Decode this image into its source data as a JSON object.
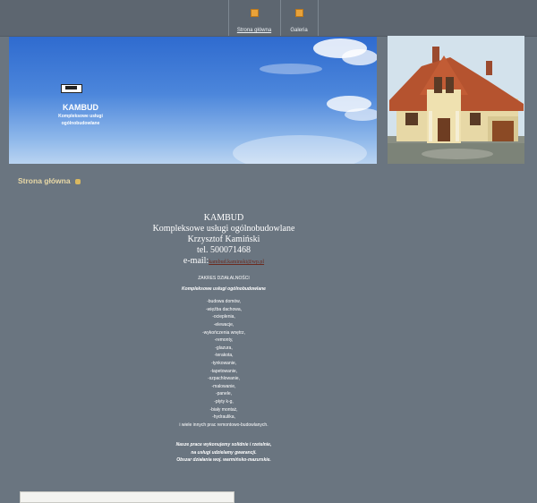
{
  "nav": {
    "items": [
      {
        "label": "Strona główna",
        "icon": "page-icon",
        "active": true
      },
      {
        "label": "Galeria",
        "icon": "page-icon",
        "active": false
      }
    ]
  },
  "banner": {
    "logo_alt": "logo",
    "name": "KAMBUD",
    "subtitle_line1": "Kompleksowe usługi",
    "subtitle_line2": "ogólnobudowlane"
  },
  "page": {
    "title": "Strona główna"
  },
  "contact": {
    "company": "KAMBUD",
    "services": "Kompleksowe usługi ogólnobudowlane",
    "owner": "Krzysztof Kamiński",
    "phone": "tel. 500071468",
    "email_label": "e-mail:",
    "email": "kambud.kaminski@wp.pl"
  },
  "scope": {
    "heading": "ZAKRES DZIAŁALNOŚCI",
    "subheading": "Kompleksowe usługi ogólnobudowlane",
    "items": [
      "-budowa domów,",
      "-więźba dachowa,",
      "-ocieplenia,",
      "-elewacje,",
      "-wykończenia wnętrz,",
      "-remonty,",
      "-glazura,",
      "-terakota,",
      "-tynkowanie,",
      "-tapetowanie,",
      "-szpachlowanie,",
      "-malowanie,",
      "-panele,",
      "-płyty k-g,",
      "-biały montaż,",
      "-hydraulika,"
    ],
    "more": "i wiele innych prac remontowo-budowlanych."
  },
  "footer_note": {
    "line1": "Nasze prace wykonujemy solidnie i rzetelnie,",
    "line2": "na usługi udzielamy gwarancji.",
    "line3": "Obszar działania woj. warmińsko-mazurskie."
  },
  "colors": {
    "background": "#6a7580",
    "topbar": "#5d6670",
    "title": "#e9d9a6",
    "email_link": "#6b2a1f"
  }
}
